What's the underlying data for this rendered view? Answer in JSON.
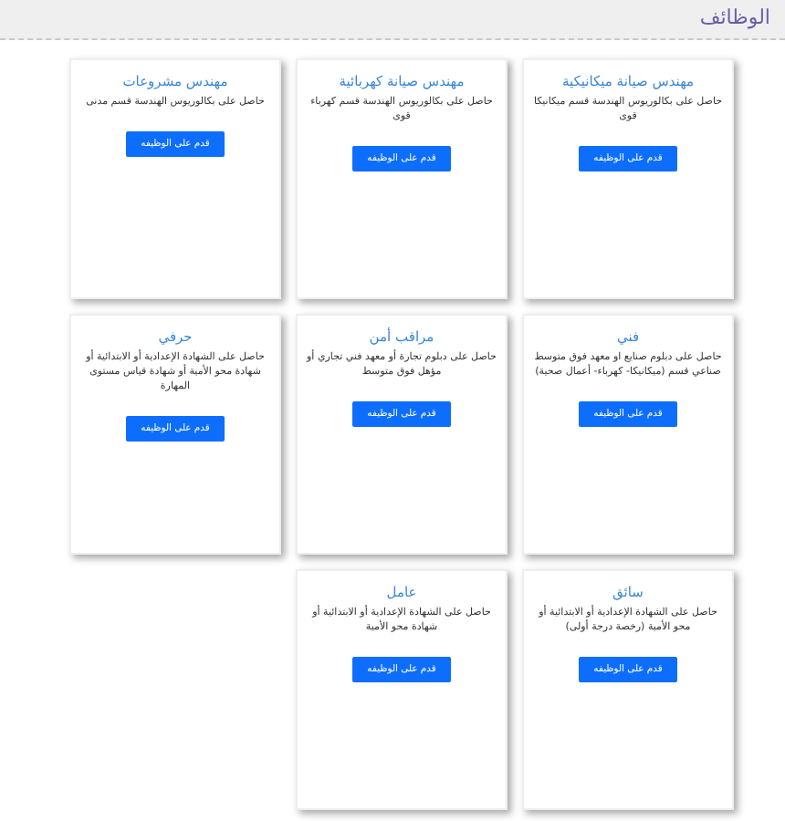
{
  "header": {
    "title": "الوظائف"
  },
  "jobs": [
    {
      "title": "مهندس صيانة ميكانيكية",
      "description": "حاصل على بكالوريوس الهندسة قسم ميكانيكا قوى",
      "button": "قدم على الوظيفه"
    },
    {
      "title": "مهندس صيانة كهربائية",
      "description": "حاصل على بكالوريوس الهندسة قسم كهرباء قوى",
      "button": "قدم على الوظيفه"
    },
    {
      "title": "مهندس مشروعات",
      "description": "حاصل على بكالوريوس الهندسة قسم مدنى",
      "button": "قدم على الوظيفه"
    },
    {
      "title": "فني",
      "description": "حاصل على دبلوم صنايع او معهد فوق متوسط صناعي قسم (ميكانيكا- كهرباء- أعمال صحية)",
      "button": "قدم على الوظيفه"
    },
    {
      "title": "مراقب أمن",
      "description": "حاصل على دبلوم تجارة أو معهد فني تجاري أو مؤهل فوق متوسط",
      "button": "قدم على الوظيفه"
    },
    {
      "title": "حرفي",
      "description": "حاصل على الشهادة الإعدادية أو الابتدائية أو شهادة محو الأمية أو شهادة قياس مستوى المهارة",
      "button": "قدم على الوظيفه"
    },
    {
      "title": "سائق",
      "description": "حاصل على الشهادة الإعدادية أو الابتدائية أو محو الأمية (رخصة درجة أولى)",
      "button": "قدم على الوظيفه"
    },
    {
      "title": "عامل",
      "description": "حاصل على الشهادة الإعدادية أو الابتدائية أو شهادة محو الأمية",
      "button": "قدم على الوظيفه"
    }
  ]
}
